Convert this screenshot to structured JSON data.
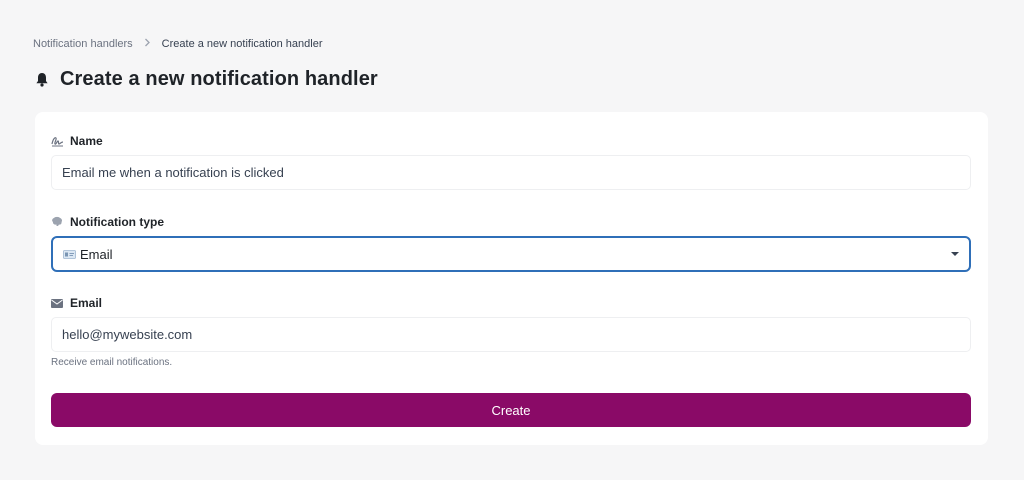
{
  "breadcrumb": {
    "parent": "Notification handlers",
    "separator": ">",
    "current": "Create a new notification handler"
  },
  "page": {
    "title": "Create a new notification handler",
    "icon": "bell-icon"
  },
  "form": {
    "name": {
      "label": "Name",
      "icon": "signature-icon",
      "value": "Email me when a notification is clicked"
    },
    "notification_type": {
      "label": "Notification type",
      "icon": "brain-icon",
      "selected": "Email",
      "selected_icon": "id-card-icon"
    },
    "email": {
      "label": "Email",
      "icon": "envelope-icon",
      "value": "hello@mywebsite.com",
      "help": "Receive email notifications."
    },
    "submit_label": "Create"
  },
  "colors": {
    "background": "#f6f6f7",
    "card": "#ffffff",
    "primary_button": "#8a0a67",
    "focus_border": "#2f6fb8"
  }
}
